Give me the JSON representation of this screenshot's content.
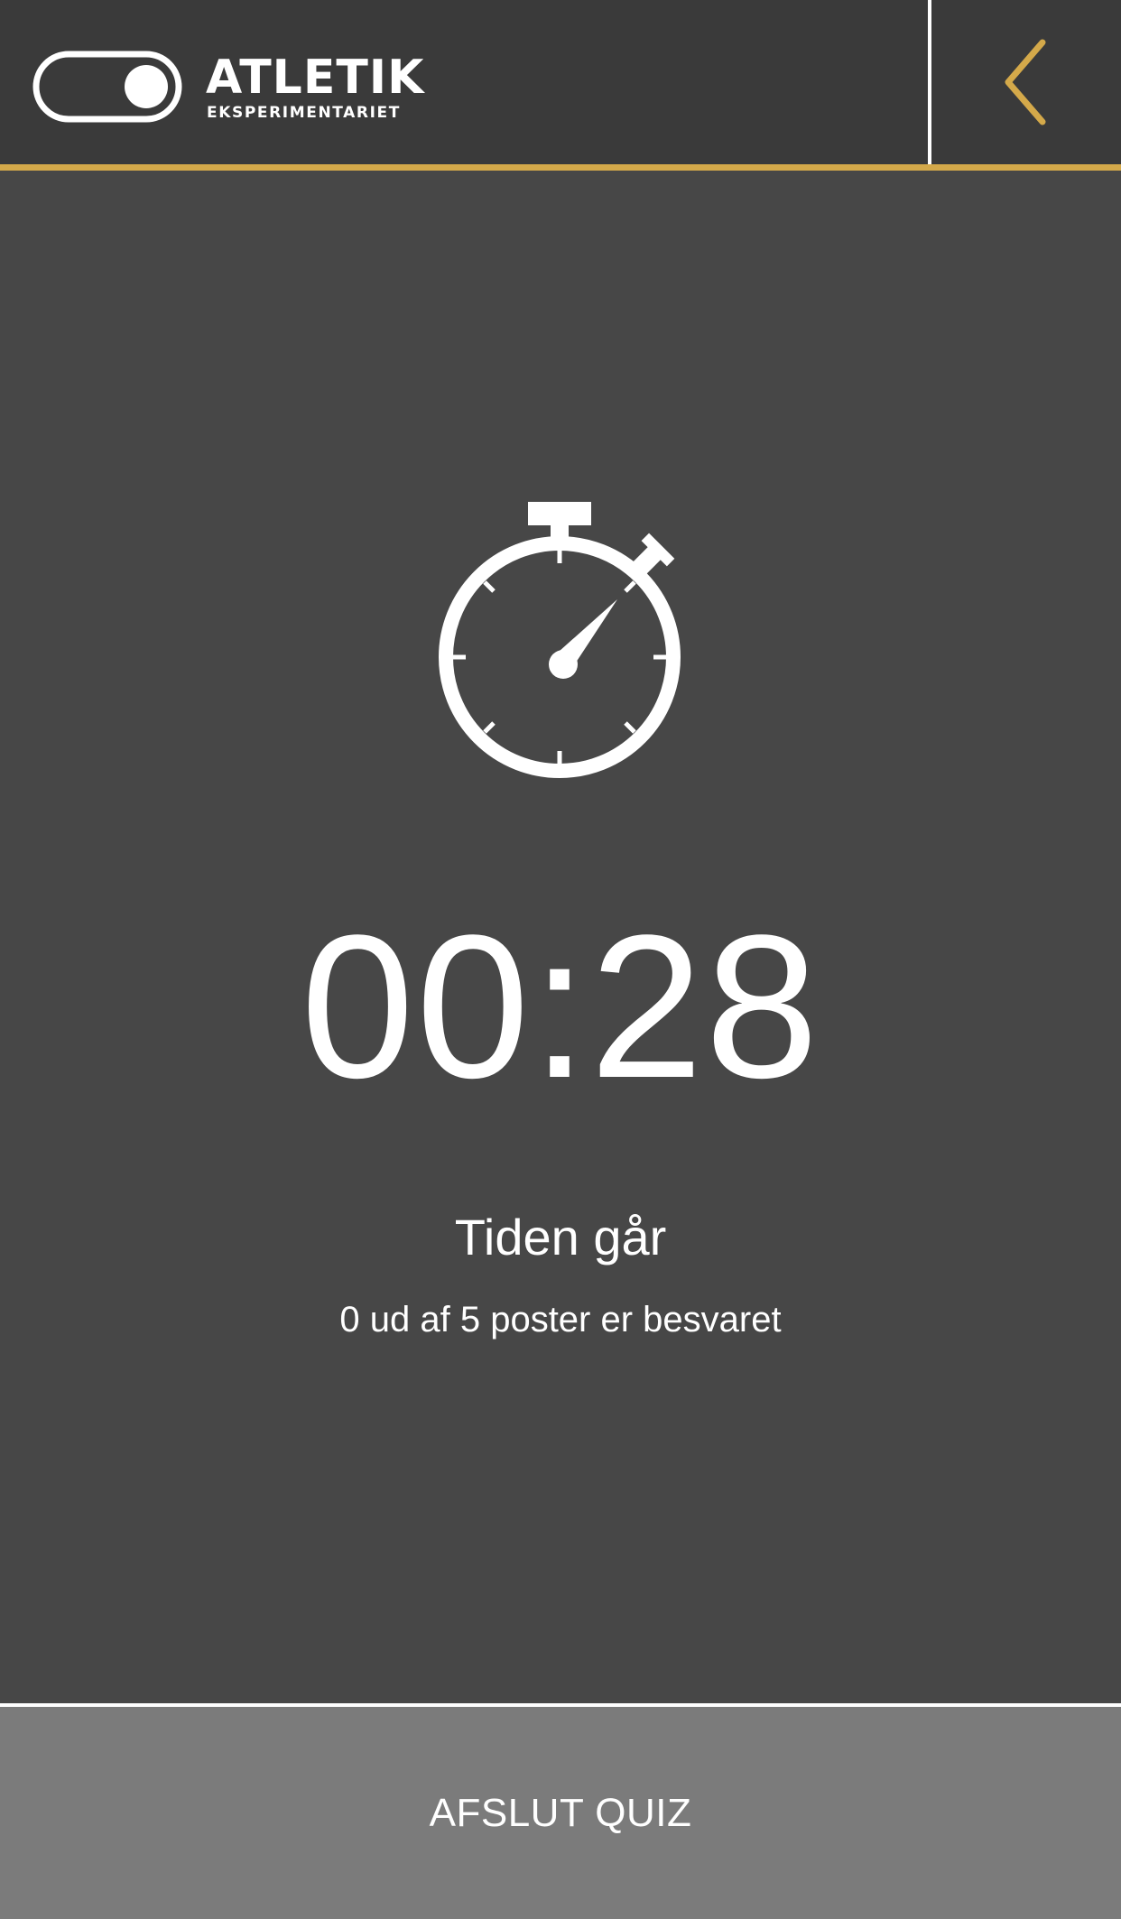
{
  "header": {
    "brand_title": "ATLETIK",
    "brand_subtitle": "EKSPERIMENTARIET",
    "back_icon": "chevron-left-icon",
    "logo_icon": "toggle-switch-icon"
  },
  "main": {
    "timer_icon": "stopwatch-icon",
    "timer_value": "00:28",
    "status_text": "Tiden går",
    "progress_text": "0 ud af 5 poster er besvaret"
  },
  "footer": {
    "finish_label": "AFSLUT QUIZ"
  },
  "colors": {
    "background": "#474747",
    "header_background": "#3a3a3a",
    "accent": "#d4a94a",
    "button_background": "#7b7b7b",
    "text": "#ffffff"
  }
}
